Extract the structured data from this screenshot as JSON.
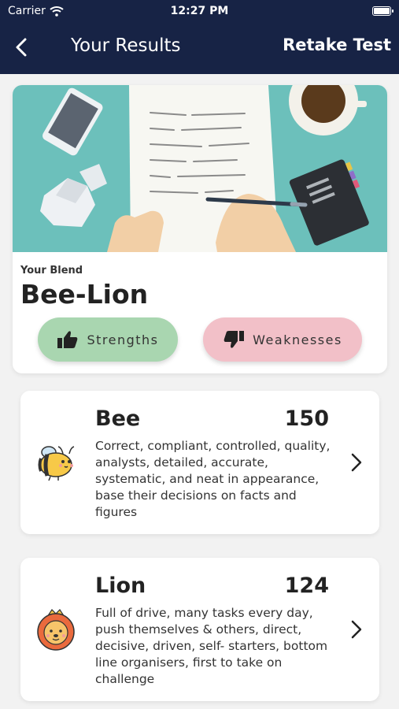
{
  "status_bar": {
    "carrier": "Carrier",
    "time": "12:27 PM"
  },
  "header": {
    "title": "Your Results",
    "retake_label": "Retake Test"
  },
  "blend": {
    "label": "Your Blend",
    "name": "Bee-Lion",
    "strengths_label": "Strengths",
    "weaknesses_label": "Weaknesses"
  },
  "results": [
    {
      "name": "Bee",
      "score": "150",
      "description": "Correct, compliant, controlled, quality, analysts, detailed, accurate, systematic, and neat in appearance, base their decisions on facts and figures",
      "icon": "bee-icon"
    },
    {
      "name": "Lion",
      "score": "124",
      "description": "Full of drive, many tasks every day, push themselves & others, direct, decisive, driven, self- starters, bottom line organisers, first to take on challenge",
      "icon": "lion-icon"
    }
  ],
  "colors": {
    "nav_bg": "#172345",
    "page_bg": "#f2f2f2",
    "hero_bg": "#6cc0bb",
    "strengths_bg": "#a9d6b0",
    "weaknesses_bg": "#f2c0c8"
  }
}
